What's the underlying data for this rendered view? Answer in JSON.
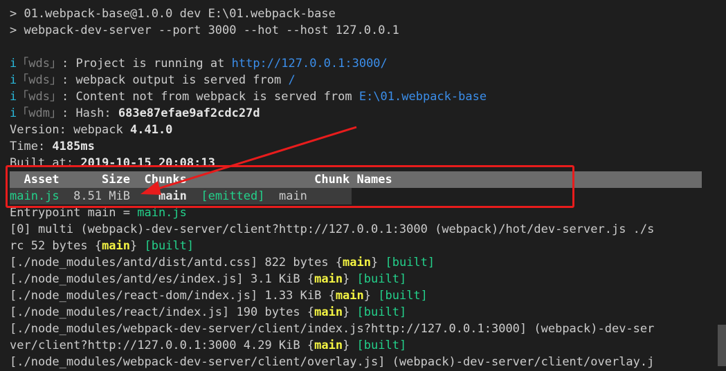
{
  "lines": {
    "l1": "> 01.webpack-base@1.0.0 dev E:\\01.webpack-base",
    "l2": "> webpack-dev-server --port 3000 --hot --host 127.0.0.1",
    "l4_prefix": "i",
    "l4_tag": "「wds」",
    "l4_text": ": Project is running at ",
    "l4_link": "http://127.0.0.1:3000/",
    "l5_prefix": "i",
    "l5_tag": "「wds」",
    "l5_text": ": webpack output is served from ",
    "l5_link": "/",
    "l6_prefix": "i",
    "l6_tag": "「wds」",
    "l6_text": ": Content not from webpack is served from ",
    "l6_link": "E:\\01.webpack-base",
    "l7_prefix": "i",
    "l7_tag": "「wdm」",
    "l7_text": ": Hash: ",
    "l7_hash": "683e87efae9af2cdc27d",
    "l8_label": "Version: webpack ",
    "l8_value": "4.41.0",
    "l9_label": "Time: ",
    "l9_value": "4185ms",
    "l10_label": "Built at: ",
    "l10_value": "2019-10-15 20:08:13",
    "table_header": "  Asset      Size  Chunks                  Chunk Names",
    "row_asset": "main.js",
    "row_size": "  8.51 MiB",
    "row_chunks": "    main",
    "row_emitted": "  [emitted]",
    "row_names": "  main",
    "l13_label": "Entrypoint main = ",
    "l13_value": "main.js",
    "l14": "[0] multi (webpack)-dev-server/client?http://127.0.0.1:3000 (webpack)/hot/dev-server.js ./s",
    "l15_a": "rc 52 bytes {",
    "l15_main": "main",
    "l15_b": "} ",
    "l15_built": "[built]",
    "l16_a": "[./node_modules/antd/dist/antd.css] 822 bytes {",
    "l16_main": "main",
    "l16_b": "} ",
    "l16_built": "[built]",
    "l17_a": "[./node_modules/antd/es/index.js] 3.1 KiB {",
    "l17_main": "main",
    "l17_b": "} ",
    "l17_built": "[built]",
    "l18_a": "[./node_modules/react-dom/index.js] 1.33 KiB {",
    "l18_main": "main",
    "l18_b": "} ",
    "l18_built": "[built]",
    "l19_a": "[./node_modules/react/index.js] 190 bytes {",
    "l19_main": "main",
    "l19_b": "} ",
    "l19_built": "[built]",
    "l20": "[./node_modules/webpack-dev-server/client/index.js?http://127.0.0.1:3000] (webpack)-dev-ser",
    "l21_a": "ver/client?http://127.0.0.1:3000 4.29 KiB {",
    "l21_main": "main",
    "l21_b": "} ",
    "l21_built": "[built]",
    "l22": "[./node_modules/webpack-dev-server/client/overlay.js] (webpack)-dev-server/client/overlay.j"
  },
  "colors": {
    "background": "#1e1e1e",
    "link": "#3b8eea",
    "green": "#23d18b",
    "yellow": "#f5f543",
    "annotation": "#e81c1c"
  }
}
